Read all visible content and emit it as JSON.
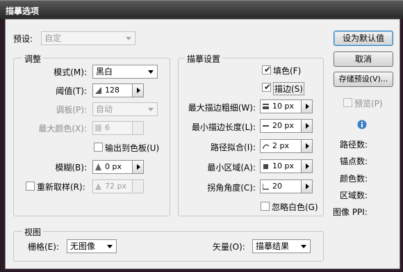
{
  "window": {
    "title": "描摹选项"
  },
  "preset": {
    "label": "预设:",
    "value": "自定"
  },
  "adjust": {
    "title": "调整",
    "mode": {
      "label": "模式(M):",
      "value": "黑白"
    },
    "threshold": {
      "label": "阈值(T):",
      "value": "128"
    },
    "palette": {
      "label": "调板(P):",
      "value": "自动"
    },
    "max_colors": {
      "label": "最大颜色(X):",
      "value": "6"
    },
    "output_swatches": {
      "label": "输出到色板(U)",
      "checked": false
    },
    "blur": {
      "label": "模糊(B):",
      "value": "0 px"
    },
    "resample": {
      "label": "重新取样(R):",
      "value": "72 px",
      "checked": false
    }
  },
  "trace_settings": {
    "title": "描摹设置",
    "fill": {
      "label": "填色(F)",
      "checked": true
    },
    "stroke": {
      "label": "描边(S)",
      "checked": true
    },
    "max_stroke_weight": {
      "label": "最大描边粗细(W):",
      "value": "10 px"
    },
    "min_stroke_length": {
      "label": "最小描边长度(L):",
      "value": "20 px"
    },
    "path_fitting": {
      "label": "路径拟合(I):",
      "value": "2 px"
    },
    "min_area": {
      "label": "最小区域(A):",
      "value": "10 px"
    },
    "corner_angle": {
      "label": "拐角角度(C):",
      "value": "20"
    },
    "ignore_white": {
      "label": "忽略白色(G)",
      "checked": false
    }
  },
  "view": {
    "title": "视图",
    "raster": {
      "label": "栅格(E):",
      "value": "无图像"
    },
    "vector": {
      "label": "矢量(O):",
      "value": "描摹结果"
    }
  },
  "buttons": {
    "set_default": "设为默认值",
    "cancel": "取消",
    "save_preset": "存储预设(V)...",
    "preview": "预览(P)"
  },
  "stats": {
    "paths": "路径数:",
    "anchors": "锚点数:",
    "colors": "颜色数:",
    "areas": "区域数:",
    "image_ppi": "图像 PPI:"
  },
  "icons": {
    "info": "info-icon",
    "triangle": "warning-triangle-icon"
  },
  "colors": {
    "title_bar": "#3c3c3c",
    "dialog_bg": "#f0f0f0",
    "default_button_border": "#3c7fb1"
  }
}
